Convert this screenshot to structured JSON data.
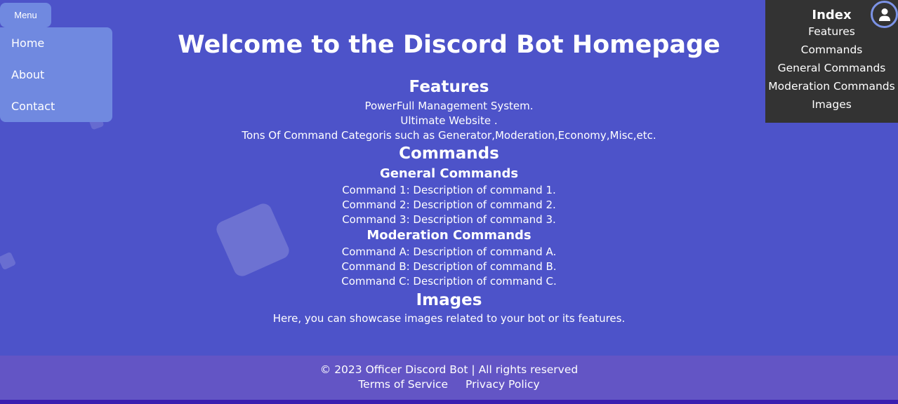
{
  "menu": {
    "button_label": "Menu",
    "items": [
      "Home",
      "About",
      "Contact"
    ]
  },
  "index": {
    "title": "Index",
    "links": [
      "Features",
      "Commands",
      "General Commands",
      "Moderation Commands",
      "Images"
    ]
  },
  "main": {
    "title": "Welcome to the Discord Bot Homepage",
    "features": {
      "heading": "Features",
      "lines": [
        "PowerFull Management System.",
        "Ultimate Website .",
        "Tons Of Command Categoris such as Generator,Moderation,Economy,Misc,etc."
      ]
    },
    "commands": {
      "heading": "Commands",
      "general": {
        "heading": "General Commands",
        "lines": [
          "Command 1: Description of command 1.",
          "Command 2: Description of command 2.",
          "Command 3: Description of command 3."
        ]
      },
      "moderation": {
        "heading": "Moderation Commands",
        "lines": [
          "Command A: Description of command A.",
          "Command B: Description of command B.",
          "Command C: Description of command C."
        ]
      }
    },
    "images": {
      "heading": "Images",
      "text": "Here, you can showcase images related to your bot or its features."
    }
  },
  "footer": {
    "copyright": "© 2023 Officer Discord Bot | All rights reserved",
    "links": [
      "Terms of Service",
      "Privacy Policy"
    ]
  },
  "icons": {
    "avatar": "user-icon"
  },
  "colors": {
    "background": "#4d53c9",
    "menu": "#7089e0",
    "index_panel": "#333333",
    "footer": "#6355c5"
  }
}
